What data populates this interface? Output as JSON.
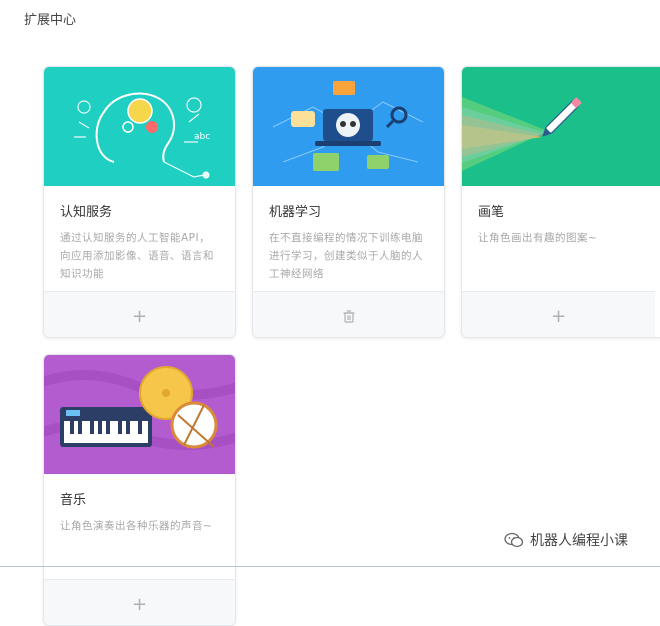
{
  "page": {
    "title": "扩展中心"
  },
  "extensions": [
    {
      "title": "认知服务",
      "description": "通过认知服务的人工智能API，向应用添加影像、语音、语言和知识功能",
      "action": "+",
      "action_icon": "plus-icon",
      "banner_color": "#1fcfc1"
    },
    {
      "title": "机器学习",
      "description": "在不直接编程的情况下训练电脑进行学习，创建类似于人脑的人工神经网络",
      "action": "🗑",
      "action_icon": "trash-icon",
      "banner_color": "#2f9cf0"
    },
    {
      "title": "画笔",
      "description": "让角色画出有趣的图案~",
      "action": "+",
      "action_icon": "plus-icon",
      "banner_color": "#1bbf8a"
    },
    {
      "title": "音乐",
      "description": "让角色演奏出各种乐器的声音~",
      "action": "+",
      "action_icon": "plus-icon",
      "banner_color": "#b35cd0"
    }
  ],
  "watermark": {
    "text": "机器人编程小课",
    "icon": "wechat-icon"
  }
}
